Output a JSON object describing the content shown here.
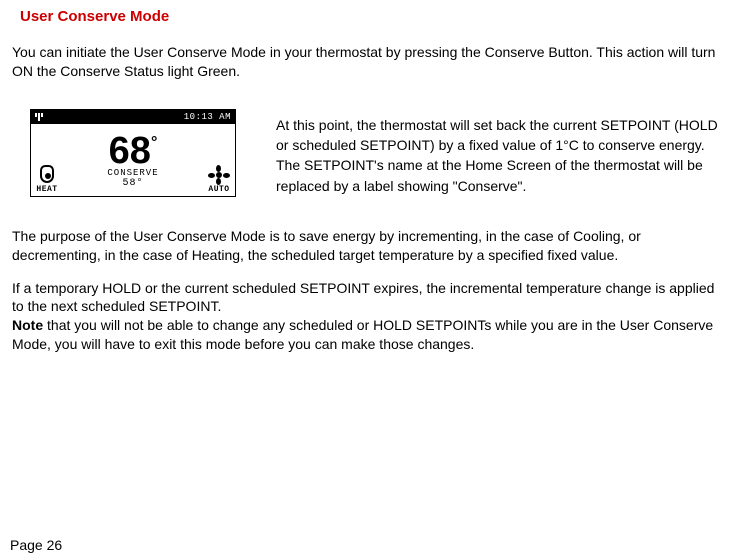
{
  "title": "User Conserve Mode",
  "intro": "You can initiate the User Conserve Mode in your thermostat by pressing the Conserve Button. This action will turn ON the Conserve Status light Green.",
  "thermo": {
    "time": "10:13 AM",
    "heat_label": "HEAT",
    "auto_label": "AUTO",
    "temp": "68",
    "deg": "°",
    "conserve_label": "CONSERVE",
    "setpoint": "58°"
  },
  "row_text": "At this point, the thermostat will set back the current SETPOINT (HOLD or scheduled SETPOINT) by a fixed value of 1°C to conserve energy. The SETPOINT's name at the Home Screen of the thermostat will be replaced by a label showing \"Conserve\".",
  "para1": "The purpose of the User Conserve Mode is to save energy by incrementing, in the case of Cooling, or decrementing, in the case of Heating, the scheduled target temperature by a specified fixed value.",
  "para2a": "If a temporary HOLD or the current scheduled SETPOINT expires, the incremental temperature change is applied to the next scheduled SETPOINT.",
  "note_label": "Note",
  "para2b": " that you will not be able to change any scheduled or HOLD SETPOINTs while you are in the User Conserve Mode, you will have to exit this mode before you can make those changes.",
  "page": "Page 26"
}
